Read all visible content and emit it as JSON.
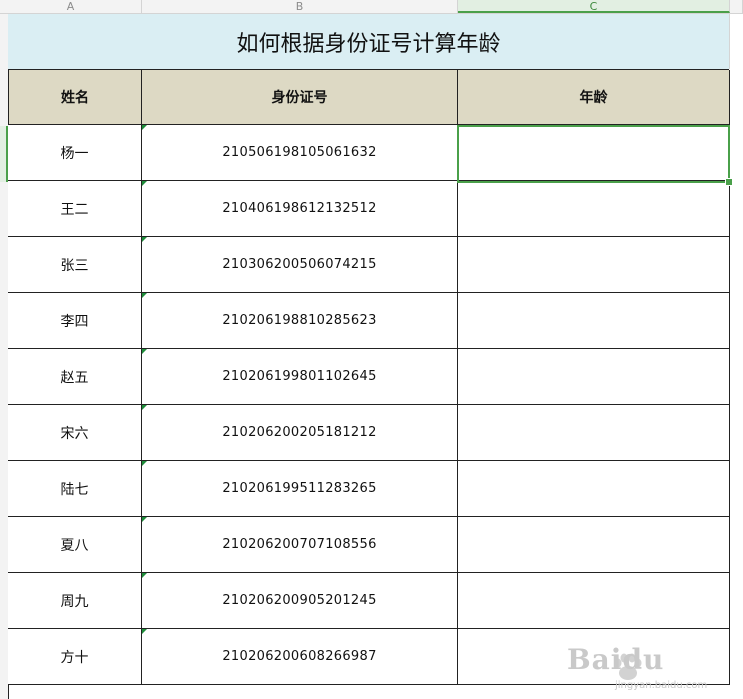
{
  "columns": [
    "A",
    "B",
    "C"
  ],
  "title": "如何根据身份证号计算年龄",
  "headers": {
    "name": "姓名",
    "id": "身份证号",
    "age": "年龄"
  },
  "rows": [
    {
      "name": "杨一",
      "id": "210506198105061632",
      "age": ""
    },
    {
      "name": "王二",
      "id": "210406198612132512",
      "age": ""
    },
    {
      "name": "张三",
      "id": "210306200506074215",
      "age": ""
    },
    {
      "name": "李四",
      "id": "210206198810285623",
      "age": ""
    },
    {
      "name": "赵五",
      "id": "210206199801102645",
      "age": ""
    },
    {
      "name": "宋六",
      "id": "210206200205181212",
      "age": ""
    },
    {
      "name": "陆七",
      "id": "210206199511283265",
      "age": ""
    },
    {
      "name": "夏八",
      "id": "210206200707108556",
      "age": ""
    },
    {
      "name": "周九",
      "id": "210206200905201245",
      "age": ""
    },
    {
      "name": "方十",
      "id": "210206200608266987",
      "age": ""
    }
  ],
  "watermark": {
    "brand": "Baidu",
    "sub": "jingyan.baidu.com"
  },
  "colors": {
    "title_bg": "#daeef3",
    "header_bg": "#ddd9c4",
    "selection": "#4aa04a"
  }
}
